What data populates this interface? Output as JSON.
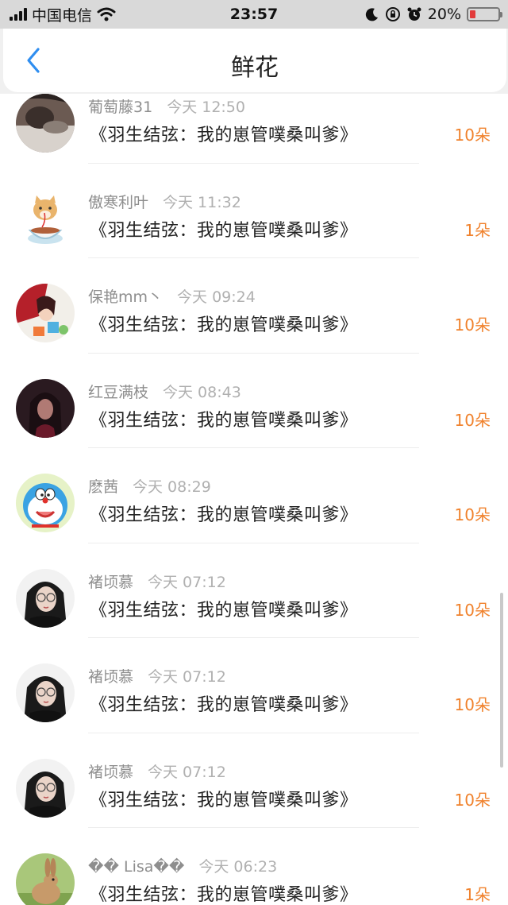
{
  "status_bar": {
    "carrier": "中国电信",
    "time": "23:57",
    "battery_percent": "20%",
    "battery_level": 0.2,
    "icons": [
      "signal-icon",
      "wifi-icon",
      "moon-icon",
      "orientation-lock-icon",
      "alarm-icon",
      "battery-icon"
    ]
  },
  "header": {
    "title": "鲜花",
    "back_icon": "chevron-left-icon"
  },
  "colors": {
    "accent_blue": "#2f8ef0",
    "count_orange": "#f0822d"
  },
  "flowers": [
    {
      "user": "葡萄藤31",
      "time": "今天 12:50",
      "book": "《羽生结弦：我的崽管噗桑叫爹》",
      "count": "10朵",
      "avatar": "cat-photo-avatar"
    },
    {
      "user": "傲寒利叶",
      "time": "今天 11:32",
      "book": "《羽生结弦：我的崽管噗桑叫爹》",
      "count": "1朵",
      "avatar": "cartoon-cat-avatar"
    },
    {
      "user": "保艳mm丶",
      "time": "今天 09:24",
      "book": "《羽生结弦：我的崽管噗桑叫爹》",
      "count": "10朵",
      "avatar": "costume-girl-avatar"
    },
    {
      "user": "红豆满枝",
      "time": "今天 08:43",
      "book": "《羽生结弦：我的崽管噗桑叫爹》",
      "count": "10朵",
      "avatar": "dark-portrait-avatar"
    },
    {
      "user": "麽茜",
      "time": "今天 08:29",
      "book": "《羽生结弦：我的崽管噗桑叫爹》",
      "count": "10朵",
      "avatar": "doraemon-avatar"
    },
    {
      "user": "褚顷慕",
      "time": "今天 07:12",
      "book": "《羽生结弦：我的崽管噗桑叫爹》",
      "count": "10朵",
      "avatar": "girl-glasses-avatar"
    },
    {
      "user": "褚顷慕",
      "time": "今天 07:12",
      "book": "《羽生结弦：我的崽管噗桑叫爹》",
      "count": "10朵",
      "avatar": "girl-glasses-avatar"
    },
    {
      "user": "褚顷慕",
      "time": "今天 07:12",
      "book": "《羽生结弦：我的崽管噗桑叫爹》",
      "count": "10朵",
      "avatar": "girl-glasses-avatar"
    },
    {
      "user": "�� Lisa��",
      "time": "今天 06:23",
      "book": "《羽生结弦：我的崽管噗桑叫爹》",
      "count": "1朵",
      "avatar": "rabbit-avatar"
    }
  ]
}
